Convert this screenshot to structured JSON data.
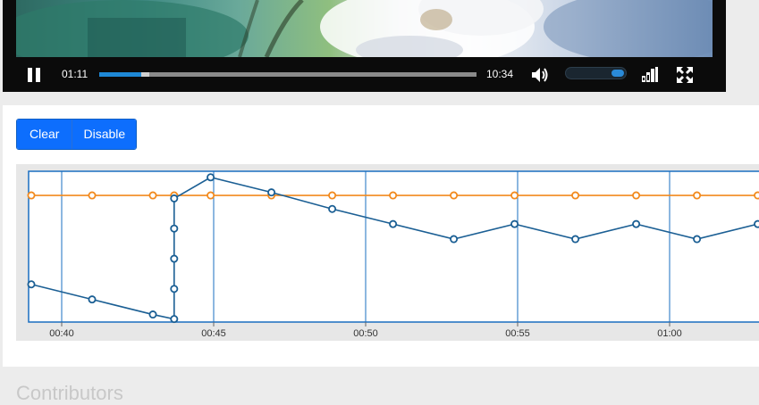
{
  "player": {
    "current_time": "01:11",
    "duration": "10:34",
    "progress_fraction": 0.112,
    "buffered_fraction": 0.132,
    "volume_fraction": 0.85,
    "icons": {
      "pause": "pause-icon",
      "volume": "volume-icon",
      "quality": "signal-bars-icon",
      "fullscreen": "fullscreen-icon"
    }
  },
  "toolbar": {
    "clear_label": "Clear",
    "disable_label": "Disable"
  },
  "colors": {
    "accent": "#0d6efd",
    "blue_series": "#1b5f94",
    "orange_series": "#f28a1e",
    "grid": "#1a6fc0"
  },
  "chart_data": {
    "type": "line",
    "x_domain": [
      "00:39",
      "01:02"
    ],
    "y_domain": [
      0,
      10
    ],
    "x_ticks": [
      {
        "value": "00:40",
        "label": "00:40"
      },
      {
        "value": "00:45",
        "label": "00:45"
      },
      {
        "value": "00:50",
        "label": "00:50"
      },
      {
        "value": "00:55",
        "label": "00:55"
      },
      {
        "value": "01:00",
        "label": "01:00"
      }
    ],
    "series": [
      {
        "color": "#f28a1e",
        "points": [
          {
            "x": "00:39.0",
            "y": 8.4
          },
          {
            "x": "00:41.0",
            "y": 8.4
          },
          {
            "x": "00:43.0",
            "y": 8.4
          },
          {
            "x": "00:43.7",
            "y": 8.4
          },
          {
            "x": "00:44.9",
            "y": 8.4
          },
          {
            "x": "00:46.9",
            "y": 8.4
          },
          {
            "x": "00:48.9",
            "y": 8.4
          },
          {
            "x": "00:50.9",
            "y": 8.4
          },
          {
            "x": "00:52.9",
            "y": 8.4
          },
          {
            "x": "00:54.9",
            "y": 8.4
          },
          {
            "x": "00:56.9",
            "y": 8.4
          },
          {
            "x": "00:58.9",
            "y": 8.4
          },
          {
            "x": "01:00.9",
            "y": 8.4
          },
          {
            "x": "01:02.9",
            "y": 8.4
          }
        ]
      },
      {
        "color": "#1b5f94",
        "points": [
          {
            "x": "00:39.0",
            "y": 2.5
          },
          {
            "x": "00:41.0",
            "y": 1.5
          },
          {
            "x": "00:43.0",
            "y": 0.5
          },
          {
            "x": "00:43.7",
            "y": 0.2
          },
          {
            "x": "00:43.7",
            "y": 2.2
          },
          {
            "x": "00:43.7",
            "y": 4.2
          },
          {
            "x": "00:43.7",
            "y": 6.2
          },
          {
            "x": "00:43.7",
            "y": 8.2
          },
          {
            "x": "00:44.9",
            "y": 9.6
          },
          {
            "x": "00:46.9",
            "y": 8.6
          },
          {
            "x": "00:48.9",
            "y": 7.5
          },
          {
            "x": "00:50.9",
            "y": 6.5
          },
          {
            "x": "00:52.9",
            "y": 5.5
          },
          {
            "x": "00:54.9",
            "y": 6.5
          },
          {
            "x": "00:56.9",
            "y": 5.5
          },
          {
            "x": "00:58.9",
            "y": 6.5
          },
          {
            "x": "01:00.9",
            "y": 5.5
          },
          {
            "x": "01:02.9",
            "y": 6.5
          }
        ]
      }
    ],
    "grid": true
  },
  "next_section": {
    "title": "Contributors"
  }
}
